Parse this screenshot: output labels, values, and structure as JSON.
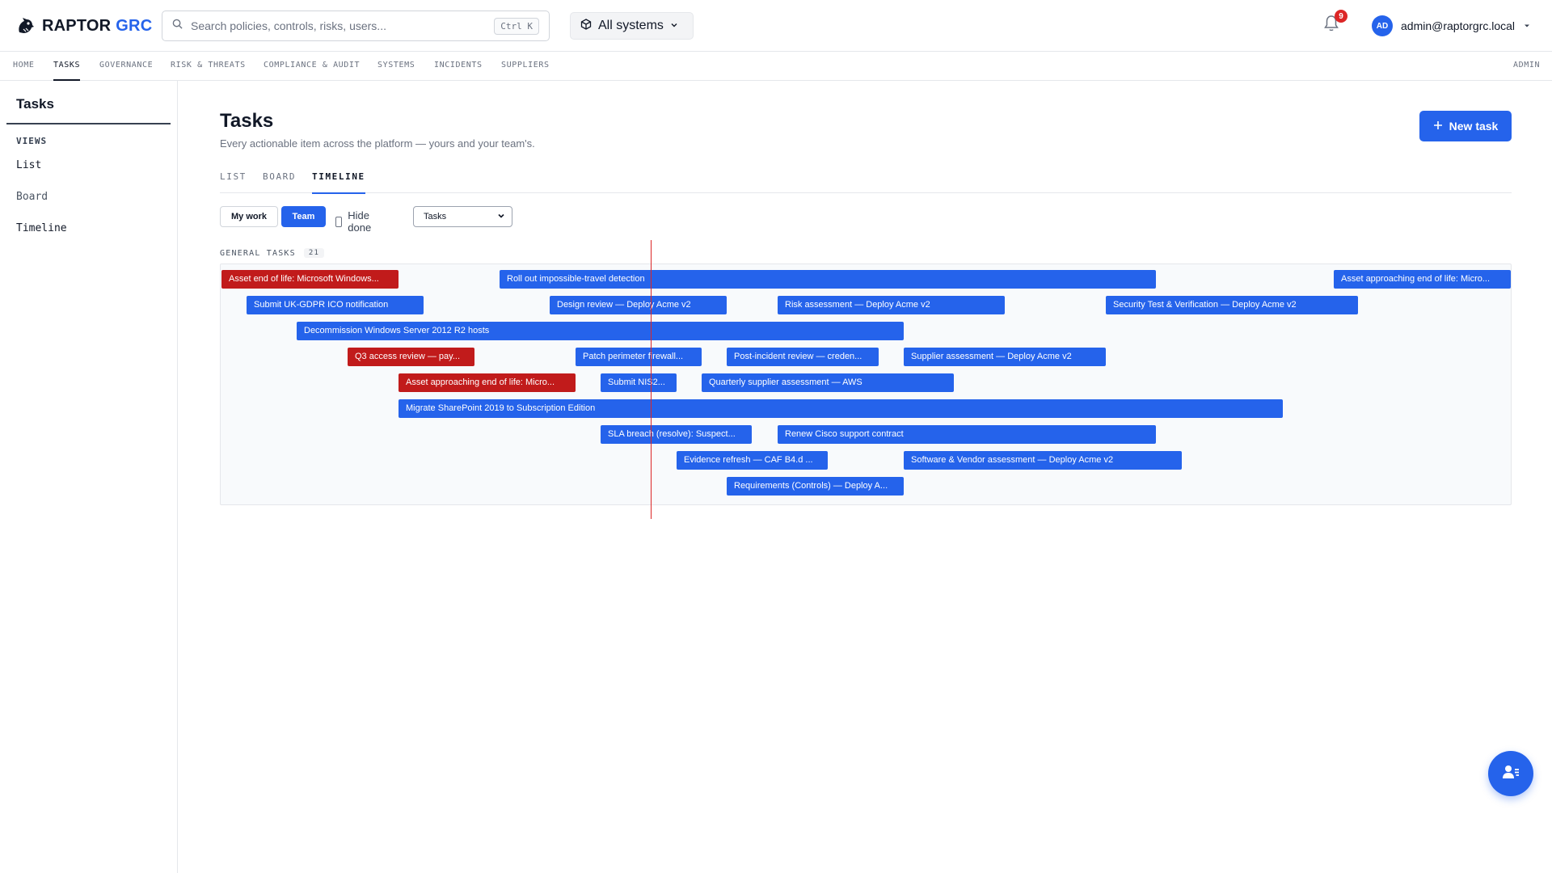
{
  "app": {
    "brand_first": "RAPTOR",
    "brand_second": "GRC",
    "accent_color": "#2563eb",
    "danger_color": "#c11b1b"
  },
  "header": {
    "search_placeholder": "Search policies, controls, risks, users...",
    "search_shortcut": "Ctrl K",
    "systems_label": "All systems",
    "notification_count": "9",
    "user_initials": "AD",
    "user_email": "admin@raptorgrc.local"
  },
  "nav": {
    "items": [
      "HOME",
      "TASKS",
      "GOVERNANCE",
      "RISK & THREATS",
      "COMPLIANCE & AUDIT",
      "SYSTEMS",
      "INCIDENTS",
      "SUPPLIERS"
    ],
    "active": "TASKS",
    "admin": "ADMIN"
  },
  "sidebar": {
    "title": "Tasks",
    "section": "VIEWS",
    "items": [
      "List",
      "Board",
      "Timeline"
    ]
  },
  "main": {
    "title": "Tasks",
    "subtitle": "Every actionable item across the platform — yours and your team's.",
    "new_task_label": "New task",
    "tabs": [
      "LIST",
      "BOARD",
      "TIMELINE"
    ],
    "active_tab": "TIMELINE",
    "filters": {
      "my_work": "My work",
      "team": "Team",
      "hide_done": "Hide done",
      "hide_done_checked": false,
      "type_select": "Tasks"
    },
    "group": {
      "label": "GENERAL TASKS",
      "count": "21"
    },
    "timeline_bars": [
      {
        "label": "Asset end of life: Microsoft Windows...",
        "status": "overdue"
      },
      {
        "label": "Roll out impossible-travel detection",
        "status": "open"
      },
      {
        "label": "Asset approaching end of life: Micro...",
        "status": "open"
      },
      {
        "label": "Submit UK-GDPR ICO notification",
        "status": "open"
      },
      {
        "label": "Design review — Deploy Acme v2",
        "status": "open"
      },
      {
        "label": "Risk assessment — Deploy Acme v2",
        "status": "open"
      },
      {
        "label": "Security Test & Verification — Deploy Acme v2",
        "status": "open"
      },
      {
        "label": "Decommission Windows Server 2012 R2 hosts",
        "status": "open"
      },
      {
        "label": "Q3 access review — pay...",
        "status": "overdue"
      },
      {
        "label": "Patch perimeter firewall...",
        "status": "open"
      },
      {
        "label": "Post-incident review — creden...",
        "status": "open"
      },
      {
        "label": "Supplier assessment — Deploy Acme v2",
        "status": "open"
      },
      {
        "label": "Asset approaching end of life: Micro...",
        "status": "overdue"
      },
      {
        "label": "Submit NIS2...",
        "status": "open"
      },
      {
        "label": "Quarterly supplier assessment — AWS",
        "status": "open"
      },
      {
        "label": "Migrate SharePoint 2019 to Subscription Edition",
        "status": "open"
      },
      {
        "label": "SLA breach (resolve): Suspect...",
        "status": "open"
      },
      {
        "label": "Renew Cisco support contract",
        "status": "open"
      },
      {
        "label": "Evidence refresh — CAF B4.d ...",
        "status": "open"
      },
      {
        "label": "Software & Vendor assessment — Deploy Acme v2",
        "status": "open"
      },
      {
        "label": "Requirements (Controls) — Deploy A...",
        "status": "open"
      }
    ]
  }
}
